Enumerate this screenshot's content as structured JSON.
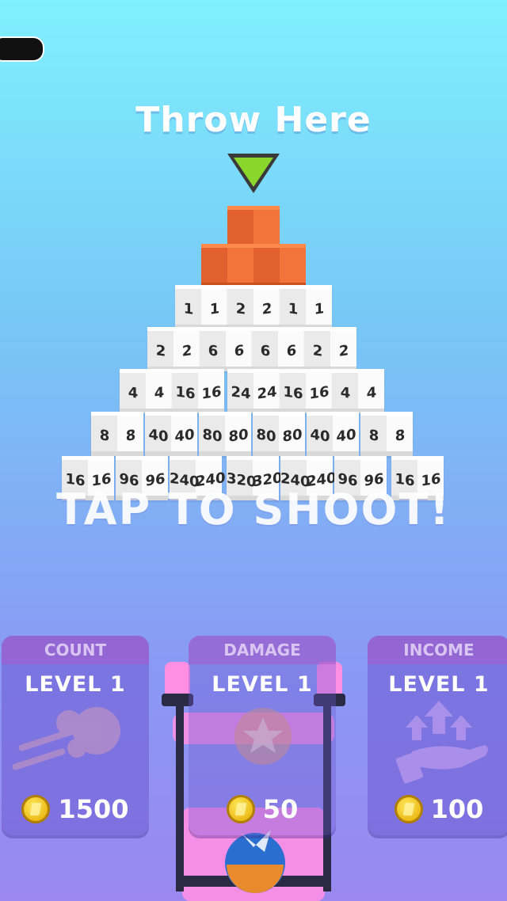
{
  "header": {
    "title": "Throw Here"
  },
  "pyramid": {
    "rows": [
      [
        "1",
        "1",
        "2",
        "2",
        "1",
        "1"
      ],
      [
        "2",
        "2",
        "6",
        "6",
        "6",
        "6",
        "2",
        "2"
      ],
      [
        "4",
        "4",
        "16",
        "16",
        "24",
        "24",
        "16",
        "16",
        "4",
        "4"
      ],
      [
        "8",
        "8",
        "40",
        "40",
        "80",
        "80",
        "80",
        "80",
        "40",
        "40",
        "8",
        "8"
      ],
      [
        "16",
        "16",
        "96",
        "96",
        "240",
        "240",
        "320",
        "320",
        "240",
        "240",
        "96",
        "96",
        "16",
        "16"
      ]
    ]
  },
  "prompt": {
    "text": "TAP TO SHOOT!"
  },
  "upgrades": {
    "count": {
      "title": "COUNT",
      "level": "LEVEL 1",
      "price": "1500"
    },
    "damage": {
      "title": "DAMAGE",
      "level": "LEVEL 1",
      "price": "50"
    },
    "income": {
      "title": "INCOME",
      "level": "LEVEL 1",
      "price": "100"
    }
  },
  "colors": {
    "accent_arrow": "#8ad62a",
    "cube_orange": "#f2743a",
    "card_bg": "#6e5ad2"
  }
}
